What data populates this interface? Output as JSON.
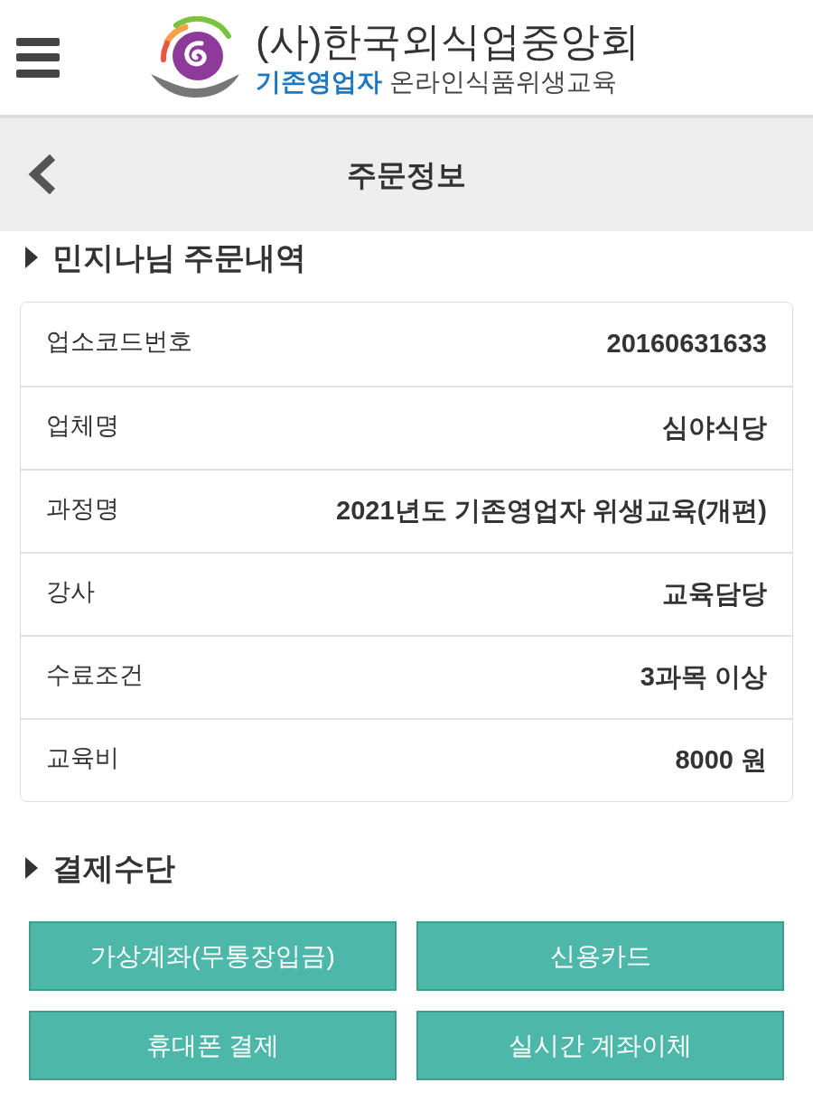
{
  "header": {
    "title": "(사)한국외식업중앙회",
    "tagline": {
      "lead": "기존영업자",
      "text": "온라인식품위생교육"
    }
  },
  "page_bar": {
    "title": "주문정보"
  },
  "order_section": {
    "heading": "민지나님 주문내역",
    "rows": [
      {
        "label": "업소코드번호",
        "value": "20160631633"
      },
      {
        "label": "업체명",
        "value": "심야식당"
      },
      {
        "label": "과정명",
        "value": "2021년도 기존영업자 위생교육(개편)"
      },
      {
        "label": "강사",
        "value": "교육담당"
      },
      {
        "label": "수료조건",
        "value": "3과목 이상"
      },
      {
        "label": "교육비",
        "value": "8000 원"
      }
    ]
  },
  "payment_section": {
    "heading": "결제수단",
    "buttons": [
      "가상계좌(무통장입금)",
      "신용카드",
      "휴대폰 결제",
      "실시간 계좌이체"
    ]
  }
}
